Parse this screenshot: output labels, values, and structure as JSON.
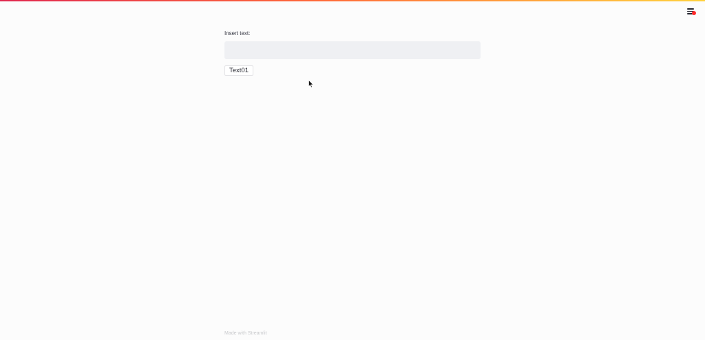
{
  "header": {
    "menu_icon": "hamburger-menu-icon",
    "notification_color": "#ff2b2b"
  },
  "main": {
    "input_label": "Insert text:",
    "input_value": "",
    "input_placeholder": "",
    "button_label": "Text01"
  },
  "footer": {
    "text": "Made with Streamlit"
  },
  "theme": {
    "background": "#fcfcfc",
    "input_background": "#eff0f3",
    "gradient": [
      "#e0284f",
      "#ff6a3a",
      "#ffd23f"
    ]
  }
}
